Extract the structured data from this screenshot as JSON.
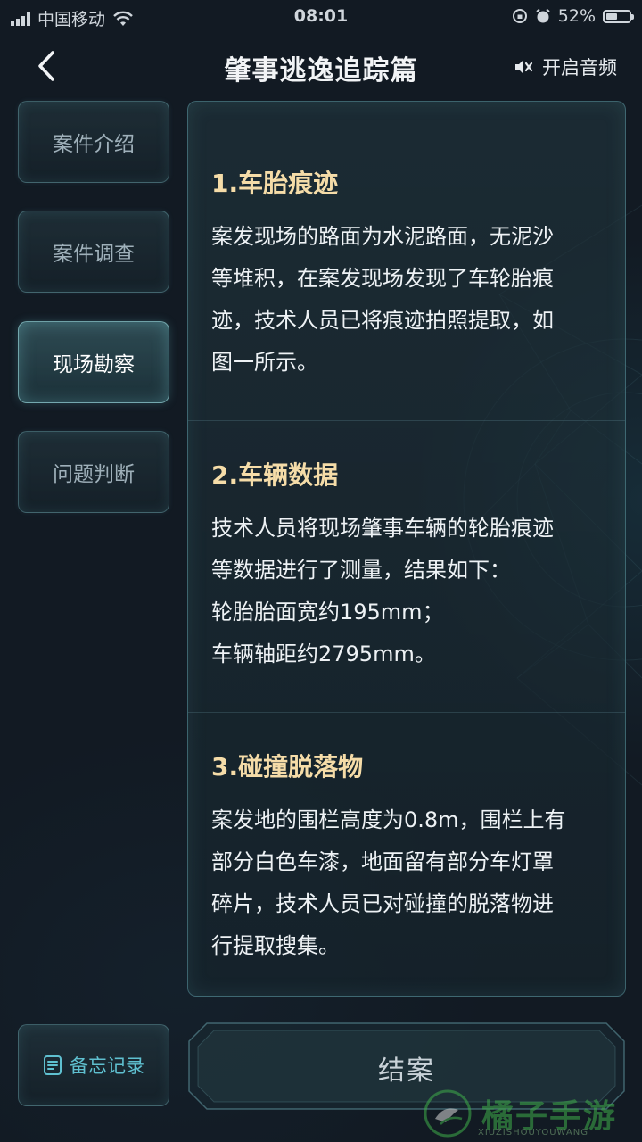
{
  "status_bar": {
    "carrier": "中国移动",
    "time": "08:01",
    "battery": "52%",
    "battery_level": 0.52
  },
  "header": {
    "back_icon": "chevron-left-icon",
    "title": "肇事逃逸追踪篇",
    "sound_icon": "speaker-muted-icon",
    "sound_label": "开启音频"
  },
  "sidebar": {
    "items": [
      {
        "label": "案件介绍",
        "active": false
      },
      {
        "label": "案件调查",
        "active": false
      },
      {
        "label": "现场勘察",
        "active": true
      },
      {
        "label": "问题判断",
        "active": false
      }
    ]
  },
  "content": {
    "sections": [
      {
        "title": "1.车胎痕迹",
        "lines": [
          "案发现场的路面为水泥路面，无泥沙",
          "等堆积，在案发现场发现了车轮胎痕",
          "迹，技术人员已将痕迹拍照提取，如",
          "图一所示。"
        ]
      },
      {
        "title": "2.车辆数据",
        "lines": [
          "技术人员将现场肇事车辆的轮胎痕迹",
          "等数据进行了测量，结果如下：",
          "轮胎胎面宽约195mm；",
          "车辆轴距约2795mm。"
        ]
      },
      {
        "title": "3.碰撞脱落物",
        "lines": [
          "案发地的围栏高度为0.8m，围栏上有",
          "部分白色车漆，地面留有部分车灯罩",
          "碎片，技术人员已对碰撞的脱落物进",
          "行提取搜集。"
        ]
      }
    ]
  },
  "bottom": {
    "memo_icon": "notes-icon",
    "memo_label": "备忘记录",
    "close_case_label": "结案"
  },
  "watermark": {
    "text": "橘子手游网",
    "sub": "XIUZISHOUYOUWANG"
  },
  "colors": {
    "accent": "#5fc0d0",
    "section_title": "#f5dca8",
    "background": "#121a23"
  }
}
